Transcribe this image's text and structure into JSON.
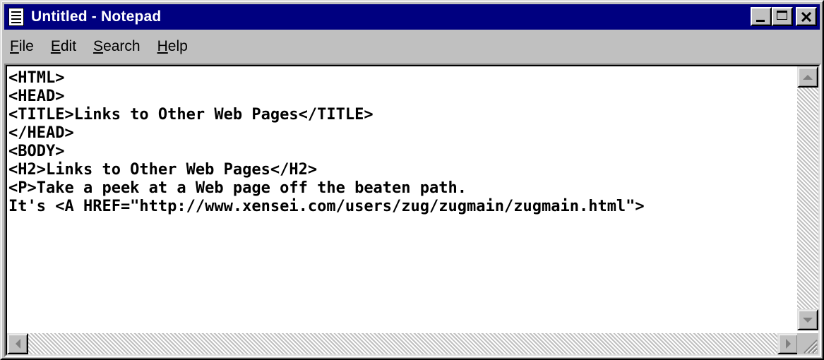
{
  "window": {
    "title": "Untitled - Notepad",
    "title_bar_color": "#000080",
    "icon": "notepad-icon"
  },
  "title_buttons": {
    "minimize": "minimize-icon",
    "maximize": "maximize-icon",
    "close": "close-icon"
  },
  "menu": {
    "items": [
      {
        "accel": "F",
        "rest": "ile"
      },
      {
        "accel": "E",
        "rest": "dit"
      },
      {
        "accel": "S",
        "rest": "earch"
      },
      {
        "accel": "H",
        "rest": "elp"
      }
    ]
  },
  "editor": {
    "lines": [
      "<HTML>",
      "<HEAD>",
      "<TITLE>Links to Other Web Pages</TITLE>",
      "</HEAD>",
      "<BODY>",
      "<H2>Links to Other Web Pages</H2>",
      "<P>Take a peek at a Web page off the beaten path.",
      "It's <A HREF=\"http://www.xensei.com/users/zug/zugmain/zugmain.html\">"
    ]
  },
  "scrollbars": {
    "up": "scroll-up-arrow-icon",
    "down": "scroll-down-arrow-icon",
    "left": "scroll-left-arrow-icon",
    "right": "scroll-right-arrow-icon",
    "size_grip": "size-grip-icon"
  }
}
